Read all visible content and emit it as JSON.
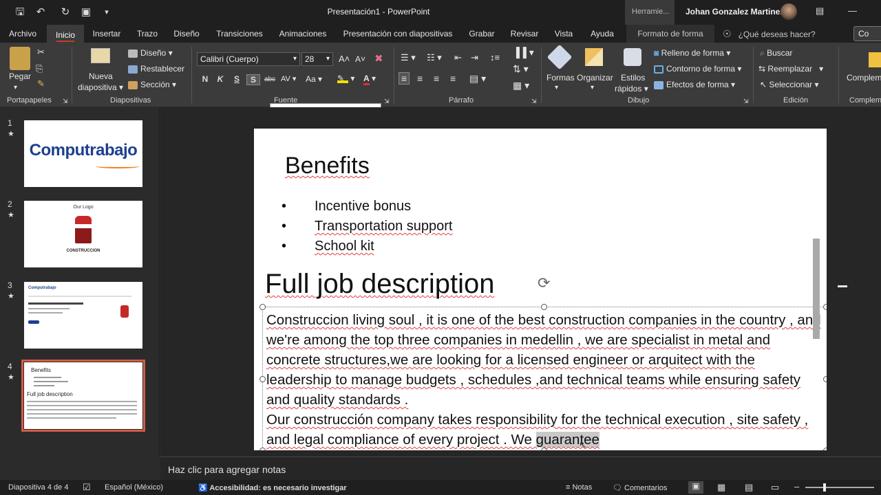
{
  "title_bar": {
    "document_title": "Presentación1 - PowerPoint",
    "tools_label": "Herramie...",
    "user_name": "Johan Gonzalez Martinez"
  },
  "tabs": [
    "Archivo",
    "Inicio",
    "Insertar",
    "Trazo",
    "Diseño",
    "Transiciones",
    "Animaciones",
    "Presentación con diapositivas",
    "Grabar",
    "Revisar",
    "Vista",
    "Ayuda",
    "Formato de forma"
  ],
  "active_tab": "Inicio",
  "tell_me": "¿Qué deseas hacer?",
  "share_label": "Co",
  "ribbon": {
    "portapapeles": {
      "paste": "Pegar",
      "group": "Portapapeles"
    },
    "diapositivas": {
      "new_slide_1": "Nueva",
      "new_slide_2": "diapositiva",
      "layout": "Diseño",
      "reset": "Restablecer",
      "section": "Sección",
      "group": "Diapositivas"
    },
    "fuente": {
      "font_name": "Calibri (Cuerpo)",
      "font_size": "28",
      "bold": "N",
      "italic": "K",
      "underline": "S",
      "shadow": "S",
      "strike": "abc",
      "spacing": "AV",
      "case": "Aa",
      "group": "Fuente"
    },
    "parrafo": {
      "group": "Párrafo"
    },
    "dibujo": {
      "shapes": "Formas",
      "arrange": "Organizar",
      "styles_1": "Estilos",
      "styles_2": "rápidos",
      "fill": "Relleno de forma",
      "outline": "Contorno de forma",
      "effects": "Efectos de forma",
      "group": "Dibujo"
    },
    "edicion": {
      "find": "Buscar",
      "replace": "Reemplazar",
      "select": "Seleccionar",
      "group": "Edición"
    },
    "complementos": {
      "label": "Complem",
      "group": "Complem"
    }
  },
  "slides": [
    {
      "number": "1",
      "star": "★",
      "logo_text": "Computrabajo"
    },
    {
      "number": "2",
      "star": "★",
      "heading": "Our Logo",
      "caption": "CONSTRUCCION"
    },
    {
      "number": "3",
      "star": "★",
      "brand": "Computrabajo"
    },
    {
      "number": "4",
      "star": "★",
      "heading": "Benefits",
      "subheading": "Full job description"
    }
  ],
  "slide": {
    "benefits_title": "Benefits",
    "bullets": [
      "Incentive bonus",
      "Transportation support",
      "School kit"
    ],
    "bullet_symbol": "•",
    "job_title": "Full job description",
    "paragraph1": "Construccion living soul , it is one of the best construction companies in the country , and we're among the top three companies in medellin , we are specialist in metal and concrete structures,we are looking for a licensed engineer or arquitect with the leadership to manage budgets , schedules ,and technical teams while ensuring safety and quality standards .",
    "paragraph2_start": "Our construcción company takes responsibility for the technical execution , site safety , and legal compliance of every project . We ",
    "paragraph2_selected": "guarantee"
  },
  "notes_placeholder": "Haz clic para agregar notas",
  "status": {
    "slide_count": "Diapositiva 4 de 4",
    "language": "Español (México)",
    "accessibility": "Accesibilidad: es necesario investigar",
    "notes": "Notas",
    "comments": "Comentarios"
  },
  "colors": {
    "accent": "#c43e1c",
    "computrabajo_blue": "#1d3f8f",
    "computrabajo_orange": "#f07f1a",
    "selection_outline": "#d35c46"
  }
}
